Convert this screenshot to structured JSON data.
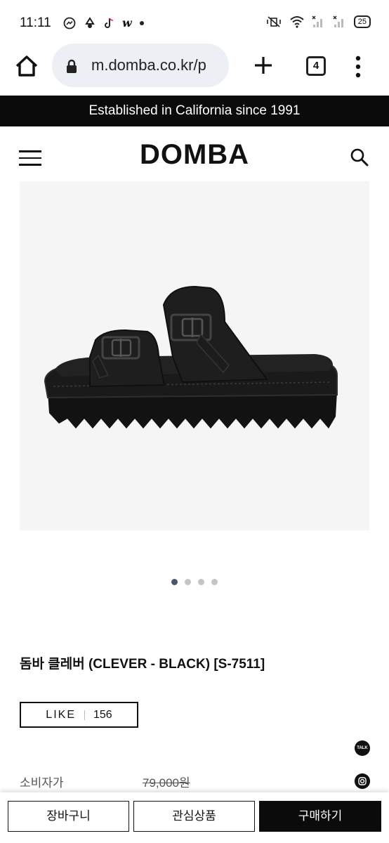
{
  "status_bar": {
    "time": "11:11",
    "battery": "25",
    "notification_icons": [
      "messenger-icon",
      "recycle-icon",
      "tiktok-icon",
      "w-app-icon",
      "dot-icon"
    ]
  },
  "browser": {
    "url": "m.domba.co.kr/p",
    "tab_count": "4"
  },
  "promo_banner": "Established in California since 1991",
  "header": {
    "logo": "DOMBA"
  },
  "carousel": {
    "total": 4,
    "active_index": 0
  },
  "product": {
    "title": "돔바 클레버 (CLEVER - BLACK) [S-7511]",
    "like_label": "LIKE",
    "like_count": "156",
    "price_label": "소비자가",
    "price_value": "79,000원"
  },
  "bottom_bar": {
    "cart": "장바구니",
    "wishlist": "관심상품",
    "buy": "구매하기"
  },
  "colors": {
    "banner_bg": "#0b0b0b",
    "image_bg": "#f5f5f5",
    "dot_active": "#4a5565",
    "dot_inactive": "#c4c4c4"
  }
}
